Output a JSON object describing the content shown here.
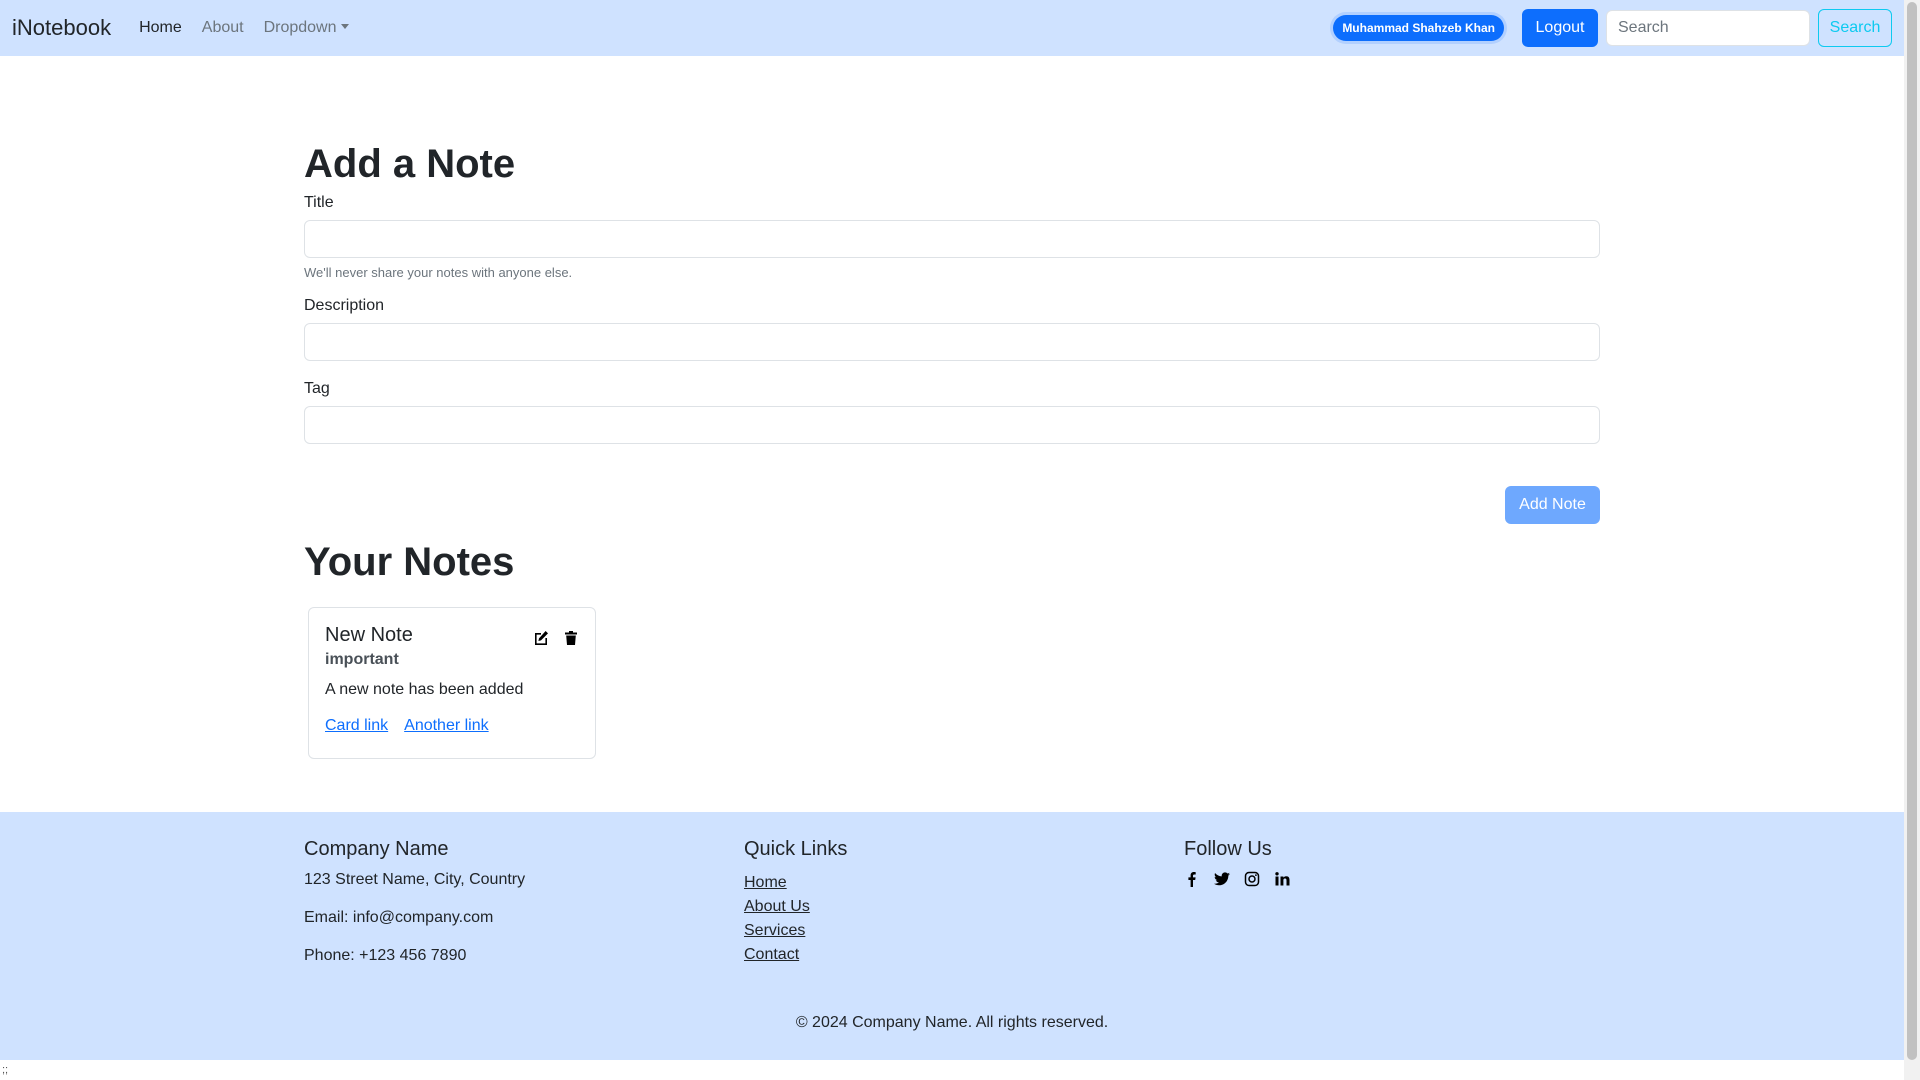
{
  "navbar": {
    "brand": "iNotebook",
    "links": [
      "Home",
      "About",
      "Dropdown"
    ],
    "user_badge": "Muhammad Shahzeb Khan",
    "logout_label": "Logout",
    "search_placeholder": "Search",
    "search_button": "Search"
  },
  "form": {
    "heading": "Add a Note",
    "title_label": "Title",
    "title_value": "",
    "help_text": "We'll never share your notes with anyone else.",
    "description_label": "Description",
    "description_value": "",
    "tag_label": "Tag",
    "tag_value": "",
    "submit_label": "Add Note"
  },
  "notes": {
    "heading": "Your Notes",
    "items": [
      {
        "title": "New Note",
        "tag": "important",
        "description": "A new note has been added",
        "link1": "Card link",
        "link2": "Another link"
      }
    ]
  },
  "footer": {
    "company_heading": "Company Name",
    "address": "123 Street Name, City, Country",
    "email": "Email: info@company.com",
    "phone": "Phone: +123 456 7890",
    "quick_links_heading": "Quick Links",
    "quick_links": [
      "Home",
      "About Us",
      "Services",
      "Contact"
    ],
    "follow_heading": "Follow Us",
    "social_icons": [
      "facebook-icon",
      "twitter-icon",
      "instagram-icon",
      "linkedin-icon"
    ],
    "copyright": "© 2024 Company Name. All rights reserved."
  },
  "status_text": ";;",
  "colors": {
    "navbar_bg": "#cfe2ff",
    "primary": "#0d6efd",
    "primary_light": "#6ea8fe",
    "info": "#0dcaf0",
    "footer_bg": "#cfe2ff"
  }
}
